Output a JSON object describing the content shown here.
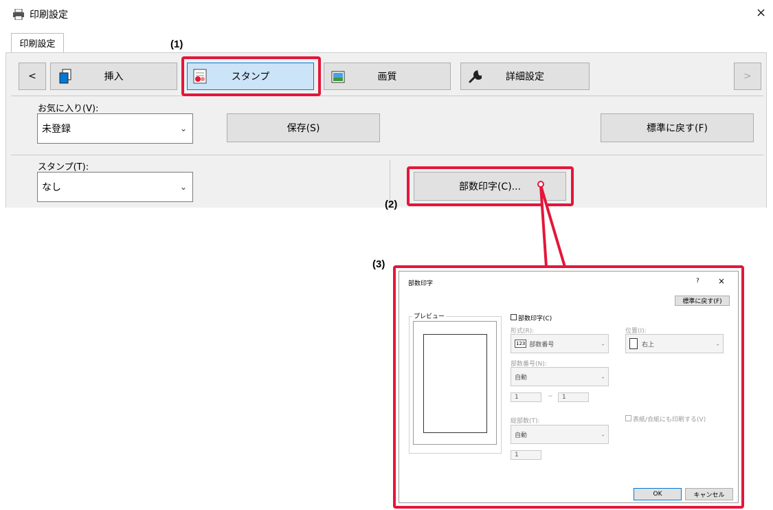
{
  "window": {
    "title": "印刷設定",
    "close": "×"
  },
  "tab": {
    "label": "印刷設定"
  },
  "toolbar": {
    "prev": "<",
    "next": ">",
    "buttons": [
      {
        "label": "挿入",
        "icon": "copy-icon"
      },
      {
        "label": "スタンプ",
        "icon": "stamp-icon",
        "selected": true
      },
      {
        "label": "画質",
        "icon": "image-icon"
      },
      {
        "label": "詳細設定",
        "icon": "wrench-icon"
      }
    ]
  },
  "favorites": {
    "label": "お気に入り(V):",
    "value": "未登録",
    "save": "保存(S)",
    "reset": "標準に戻す(F)"
  },
  "stamp": {
    "label": "スタンプ(T):",
    "value": "なし",
    "copy_print_button": "部数印字(C)..."
  },
  "annotations": {
    "a1": "(1)",
    "a2": "(2)",
    "a3": "(3)"
  },
  "accent_red": "#e4163a",
  "sub_dialog": {
    "title": "部数印字",
    "help": "?",
    "close": "×",
    "reset": "標準に戻す(F)",
    "preview_label": "プレビュー",
    "enable_checkbox": "部数印字(C)",
    "format_label": "形式(R):",
    "format_icon_text": "123",
    "format_value": "部数番号",
    "position_label": "位置(I):",
    "position_value": "右上",
    "number_label": "部数番号(N):",
    "number_value": "自動",
    "range_from": "1",
    "range_sep": "~",
    "range_to": "1",
    "total_label": "総部数(T):",
    "total_value": "自動",
    "total_number": "1",
    "cover_checkbox": "表紙/合紙にも印刷する(V)",
    "ok": "OK",
    "cancel": "キャンセル"
  }
}
